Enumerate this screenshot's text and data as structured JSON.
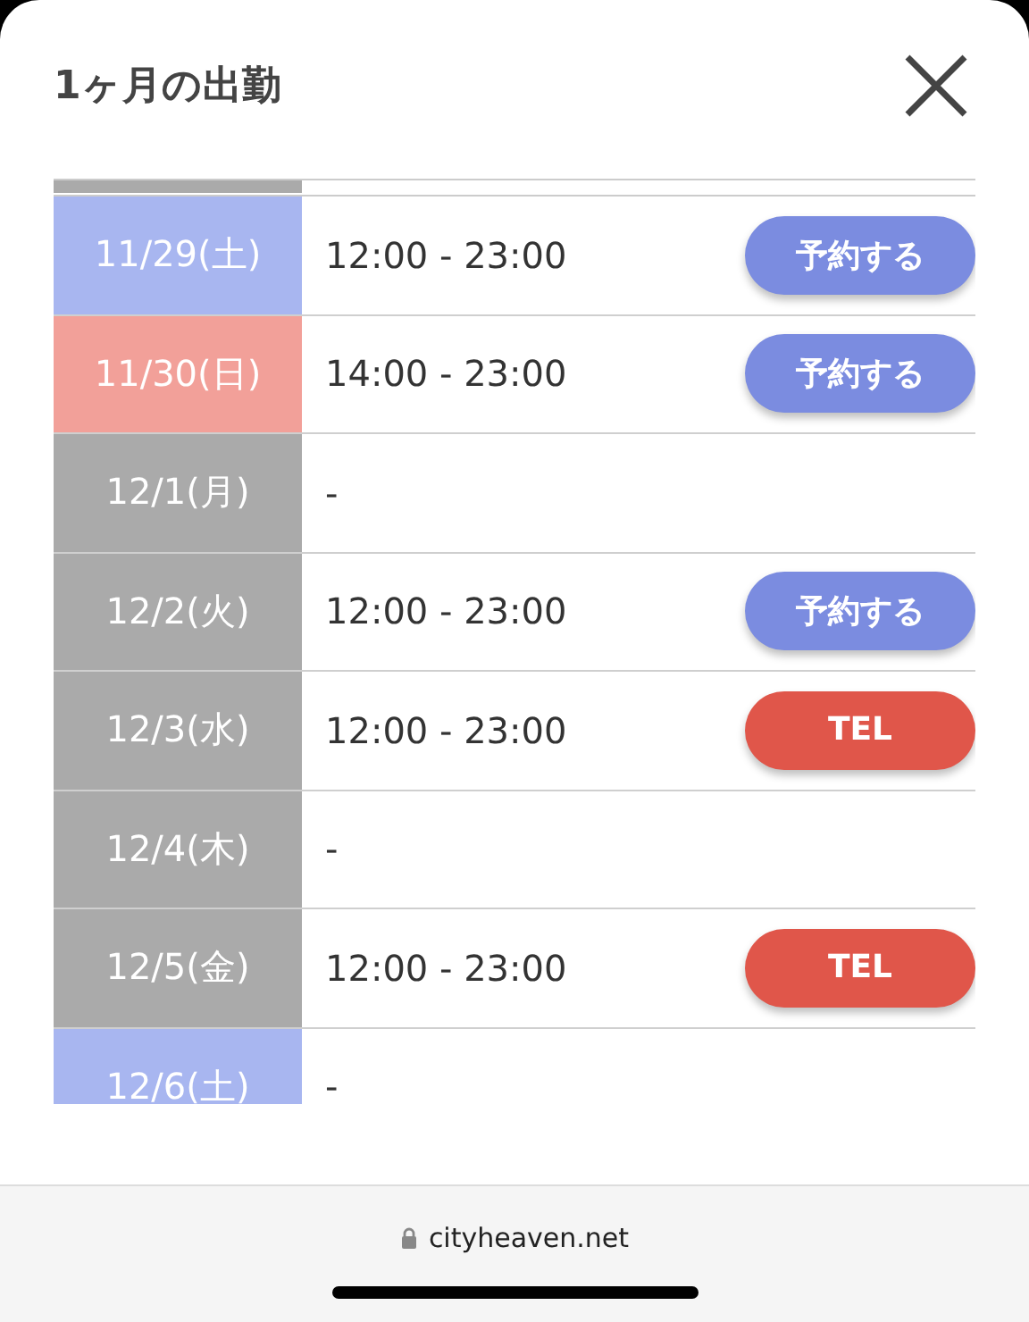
{
  "modal": {
    "title": "1ヶ月の出勤"
  },
  "schedule": [
    {
      "date": "11/29(土)",
      "color": "#a8b6f0",
      "hours": "12:00 - 23:00",
      "action": {
        "kind": "reserve",
        "label": "予約する"
      }
    },
    {
      "date": "11/30(日)",
      "color": "#f2a099",
      "hours": "14:00 - 23:00",
      "action": {
        "kind": "reserve",
        "label": "予約する"
      }
    },
    {
      "date": "12/1(月)",
      "color": "#aaaaaa",
      "hours": "-"
    },
    {
      "date": "12/2(火)",
      "color": "#aaaaaa",
      "hours": "12:00 - 23:00",
      "action": {
        "kind": "reserve",
        "label": "予約する"
      }
    },
    {
      "date": "12/3(水)",
      "color": "#aaaaaa",
      "hours": "12:00 - 23:00",
      "action": {
        "kind": "tel",
        "label": "TEL"
      }
    },
    {
      "date": "12/4(木)",
      "color": "#aaaaaa",
      "hours": "-"
    },
    {
      "date": "12/5(金)",
      "color": "#aaaaaa",
      "hours": "12:00 - 23:00",
      "action": {
        "kind": "tel",
        "label": "TEL"
      }
    },
    {
      "date": "12/6(土)",
      "color": "#a8b6f0",
      "hours": "-"
    }
  ],
  "browser_bar": {
    "url": "cityheaven.net"
  }
}
